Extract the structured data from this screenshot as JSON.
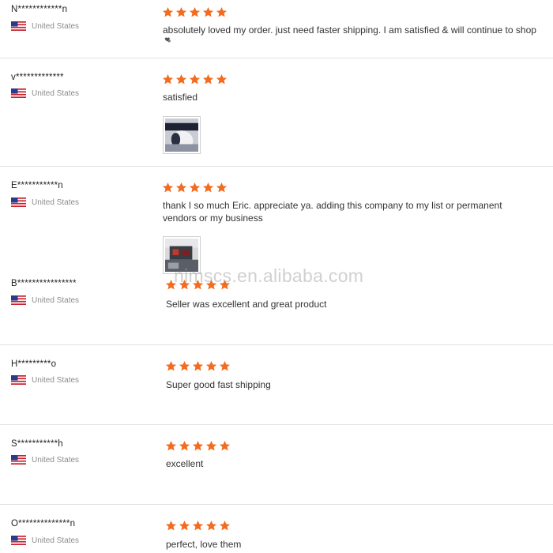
{
  "accent_color": "#f26b1f",
  "reviews": [
    {
      "user": "N************n",
      "country": "United States",
      "stars": 5,
      "text": "absolutely loved my order. just need faster shipping. I am satisfied & will continue to shop",
      "extra_icon": "hearts-icon"
    },
    {
      "user": "v*************",
      "country": "United States",
      "stars": 5,
      "text": "satisfied",
      "photo": "review-photo-1"
    },
    {
      "user": "E***********n",
      "country": "United States",
      "stars": 5,
      "text": "thank I so much Eric.  appreciate ya.  adding this company to my list or permanent vendors or my business",
      "photo": "review-photo-2"
    },
    {
      "user": "B****************",
      "country": "United States",
      "stars": 5,
      "text": "Seller was excellent and great product"
    },
    {
      "user": "H*********o",
      "country": "United States",
      "stars": 5,
      "text": "Super good fast shipping"
    },
    {
      "user": "S***********h",
      "country": "United States",
      "stars": 5,
      "text": "excellent"
    },
    {
      "user": "O**************n",
      "country": "United States",
      "stars": 5,
      "text": "perfect, love them"
    }
  ],
  "watermark": "nimscs.en.alibaba.com"
}
